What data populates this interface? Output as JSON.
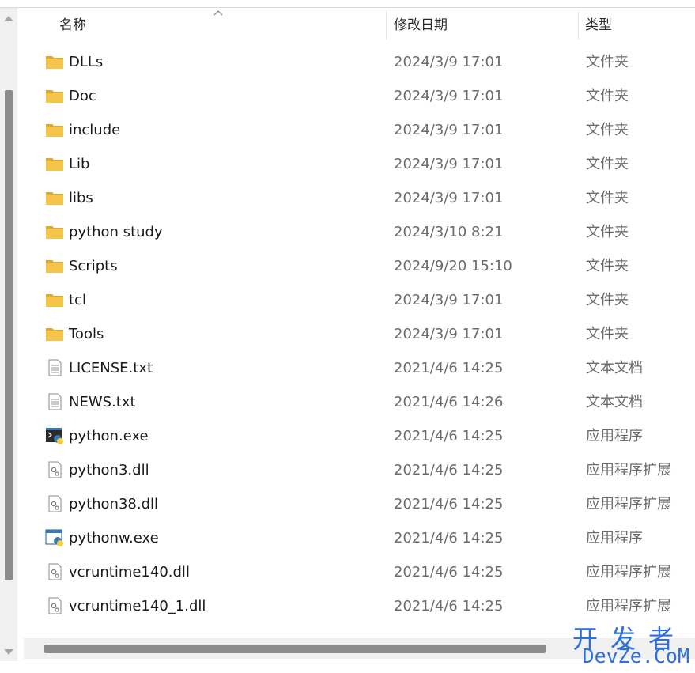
{
  "columns": {
    "name": "名称",
    "date": "修改日期",
    "type": "类型"
  },
  "files": [
    {
      "name": "DLLs",
      "date": "2024/3/9 17:01",
      "type": "文件夹",
      "icon": "folder-icon"
    },
    {
      "name": "Doc",
      "date": "2024/3/9 17:01",
      "type": "文件夹",
      "icon": "folder-icon"
    },
    {
      "name": "include",
      "date": "2024/3/9 17:01",
      "type": "文件夹",
      "icon": "folder-icon"
    },
    {
      "name": "Lib",
      "date": "2024/3/9 17:01",
      "type": "文件夹",
      "icon": "folder-icon"
    },
    {
      "name": "libs",
      "date": "2024/3/9 17:01",
      "type": "文件夹",
      "icon": "folder-icon"
    },
    {
      "name": "python study",
      "date": "2024/3/10 8:21",
      "type": "文件夹",
      "icon": "folder-icon"
    },
    {
      "name": "Scripts",
      "date": "2024/9/20 15:10",
      "type": "文件夹",
      "icon": "folder-icon"
    },
    {
      "name": "tcl",
      "date": "2024/3/9 17:01",
      "type": "文件夹",
      "icon": "folder-icon"
    },
    {
      "name": "Tools",
      "date": "2024/3/9 17:01",
      "type": "文件夹",
      "icon": "folder-icon"
    },
    {
      "name": "LICENSE.txt",
      "date": "2021/4/6 14:25",
      "type": "文本文档",
      "icon": "text-file-icon"
    },
    {
      "name": "NEWS.txt",
      "date": "2021/4/6 14:26",
      "type": "文本文档",
      "icon": "text-file-icon"
    },
    {
      "name": "python.exe",
      "date": "2021/4/6 14:25",
      "type": "应用程序",
      "icon": "python-console-icon"
    },
    {
      "name": "python3.dll",
      "date": "2021/4/6 14:25",
      "type": "应用程序扩展",
      "icon": "dll-file-icon"
    },
    {
      "name": "python38.dll",
      "date": "2021/4/6 14:25",
      "type": "应用程序扩展",
      "icon": "dll-file-icon"
    },
    {
      "name": "pythonw.exe",
      "date": "2021/4/6 14:25",
      "type": "应用程序",
      "icon": "python-window-icon"
    },
    {
      "name": "vcruntime140.dll",
      "date": "2021/4/6 14:25",
      "type": "应用程序扩展",
      "icon": "dll-file-icon"
    },
    {
      "name": "vcruntime140_1.dll",
      "date": "2021/4/6 14:25",
      "type": "应用程序扩展",
      "icon": "dll-file-icon"
    }
  ],
  "watermark": {
    "cn": "开发者",
    "en": "DevZe.CoM"
  },
  "colors": {
    "folder": "#f4c54a",
    "folder_dark": "#e0a82e",
    "watermark": "#2f6fd8",
    "scroll_thumb": "#8c8c8c"
  }
}
